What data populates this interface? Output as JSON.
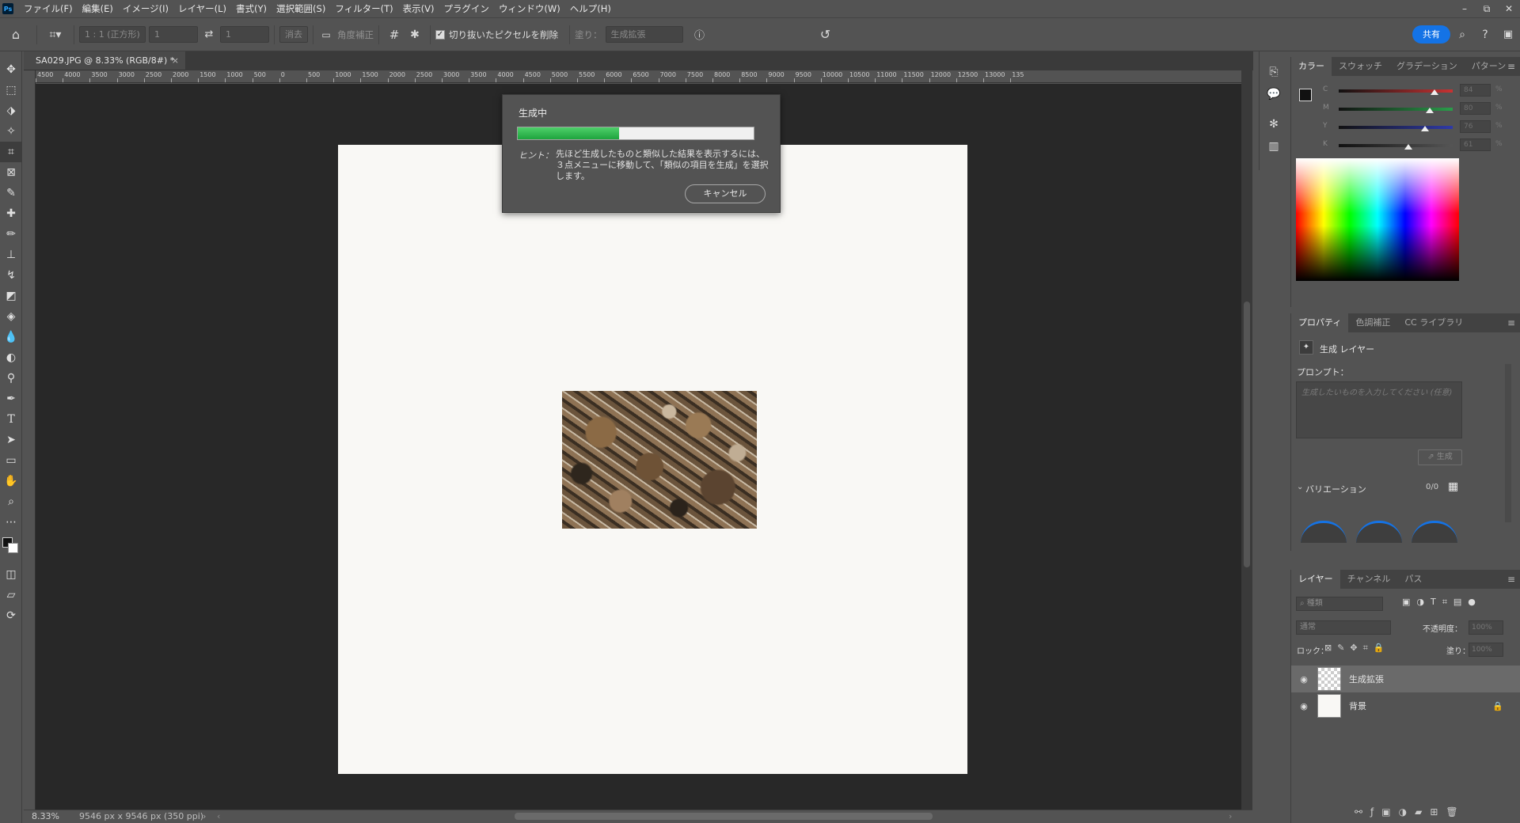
{
  "app": {
    "logo": "Ps"
  },
  "menu": [
    "ファイル(F)",
    "編集(E)",
    "イメージ(I)",
    "レイヤー(L)",
    "書式(Y)",
    "選択範囲(S)",
    "フィルター(T)",
    "表示(V)",
    "プラグイン",
    "ウィンドウ(W)",
    "ヘルプ(H)"
  ],
  "window_controls": {
    "minimize": "–",
    "restore": "⧉",
    "close": "✕"
  },
  "options_bar": {
    "ratio_select": "1 : 1 (正方形)",
    "width_value": "1",
    "height_value": "1",
    "clear_label": "消去",
    "straighten_label": "角度補正",
    "delete_cropped_label": "切り抜いたピクセルを削除",
    "fill_label": "塗り：",
    "fill_select": "生成拡張",
    "share_label": "共有"
  },
  "document": {
    "tab_title": "SA029.JPG @ 8.33% (RGB/8#) *",
    "zoom": "8.33%",
    "doc_info": "9546 px x 9546 px (350 ppi)"
  },
  "ruler_labels": [
    "4500",
    "4000",
    "3500",
    "3000",
    "2500",
    "2000",
    "1500",
    "1000",
    "500",
    "0",
    "500",
    "1000",
    "1500",
    "2000",
    "2500",
    "3000",
    "3500",
    "4000",
    "4500",
    "5000",
    "5500",
    "6000",
    "6500",
    "7000",
    "7500",
    "8000",
    "8500",
    "9000",
    "9500",
    "10000",
    "10500",
    "11000",
    "11500",
    "12000",
    "12500",
    "13000",
    "135"
  ],
  "dialog": {
    "title": "生成中",
    "progress": 0.43,
    "hint_label": "ヒント：",
    "hint_text": "先ほど生成したものと類似した結果を表示するには、３点メニューに移動して、「類似の項目を生成」を選択します。",
    "cancel_label": "キャンセル"
  },
  "color_panel": {
    "tabs": [
      "カラー",
      "スウォッチ",
      "グラデーション",
      "パターン"
    ],
    "sliders": [
      {
        "label": "C",
        "value": "84",
        "level": 0.84,
        "color": "#c83232"
      },
      {
        "label": "M",
        "value": "80",
        "level": 0.8,
        "color": "#2a9d4a"
      },
      {
        "label": "Y",
        "value": "76",
        "level": 0.76,
        "color": "#2f3aa8"
      },
      {
        "label": "K",
        "value": "61",
        "level": 0.61,
        "color": "#555555"
      }
    ],
    "unit": "%"
  },
  "properties_panel": {
    "tabs": [
      "プロパティ",
      "色調補正",
      "CC ライブラリ"
    ],
    "layer_type": "生成 レイヤー",
    "prompt_label": "プロンプト：",
    "prompt_placeholder": "生成したいものを入力してください (任意)",
    "generate_label": "生成",
    "variations_label": "バリエーション",
    "variations_count": "0/0"
  },
  "layers_panel": {
    "tabs": [
      "レイヤー",
      "チャンネル",
      "パス"
    ],
    "search_placeholder": "種類",
    "blend_mode": "通常",
    "opacity_label": "不透明度：",
    "opacity_value": "100%",
    "lock_label": "ロック：",
    "fill_label": "塗り：",
    "fill_value": "100%",
    "layers": [
      {
        "name": "生成拡張",
        "selected": true
      },
      {
        "name": "背景",
        "selected": false
      }
    ]
  },
  "colors": {
    "accent": "#1473e6",
    "progress": "#1ea43e",
    "canvas_bg": "#282828",
    "artboard": "#f9f8f5"
  }
}
